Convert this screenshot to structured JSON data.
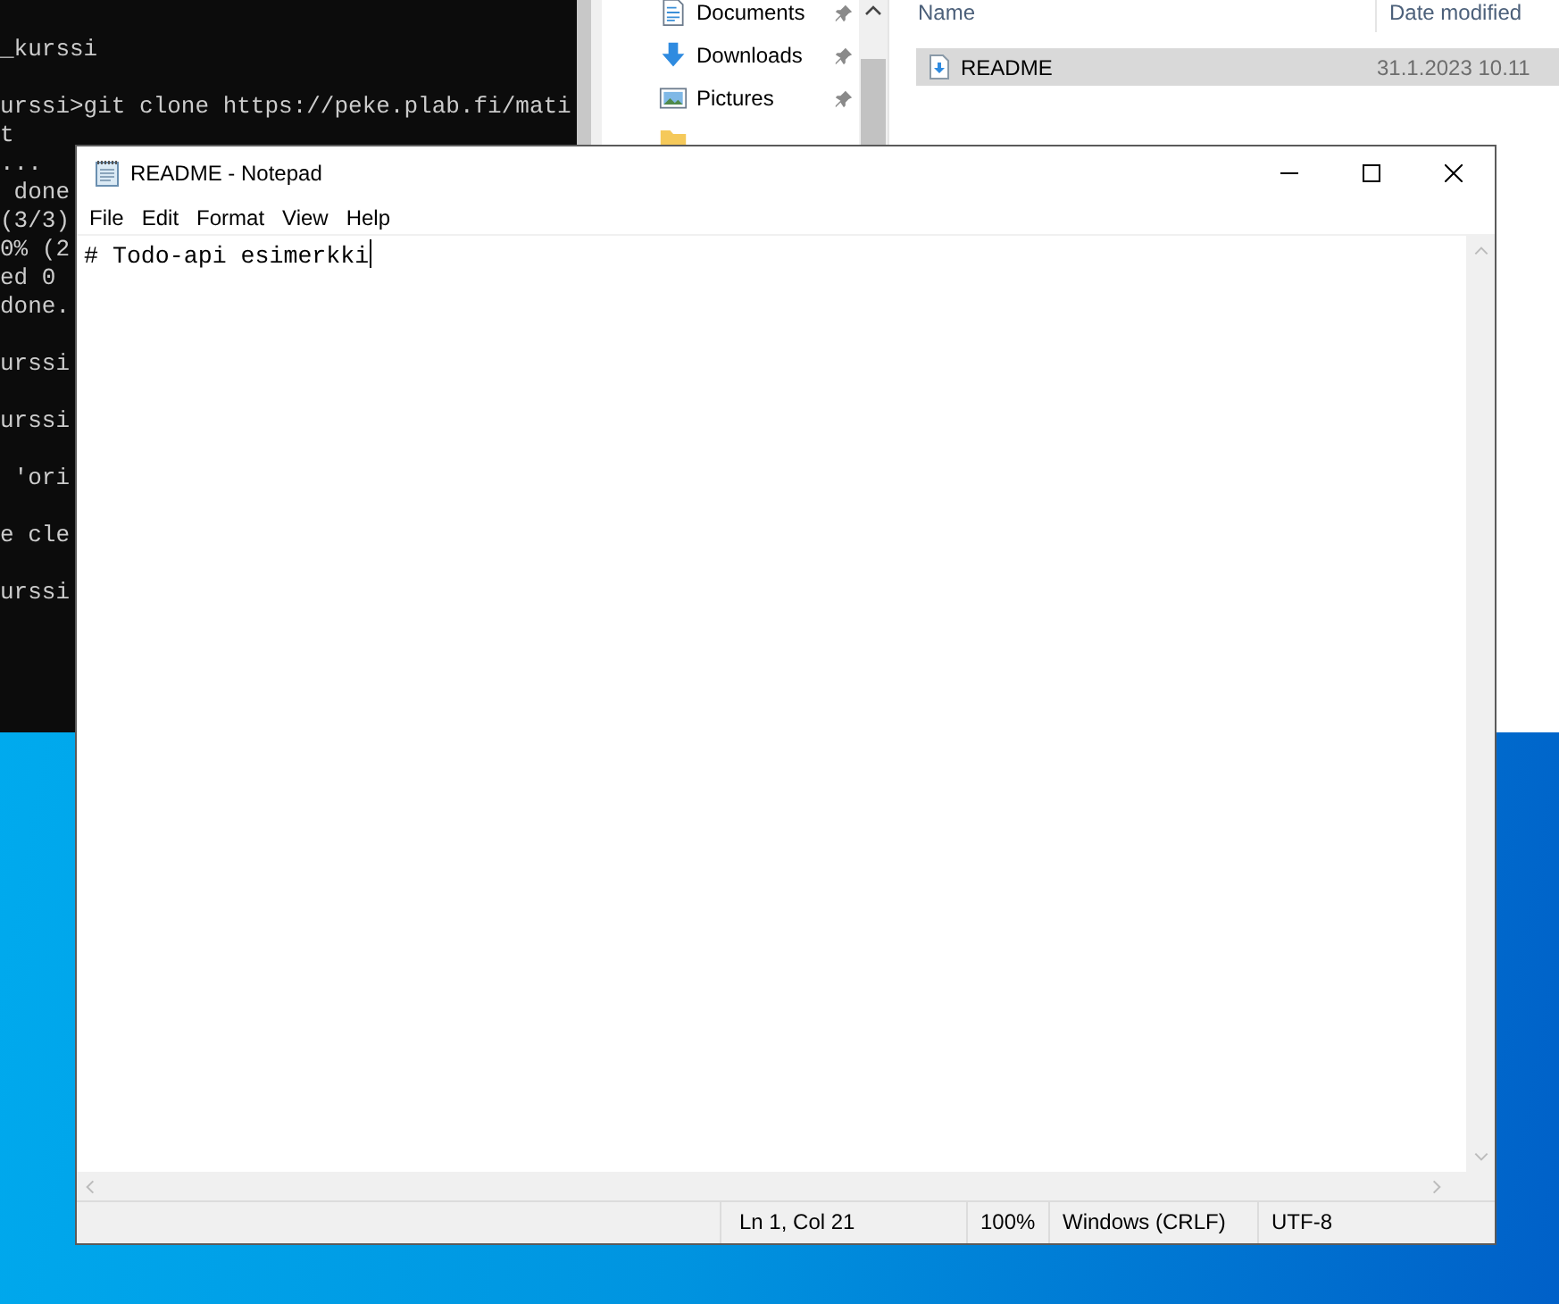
{
  "terminal": {
    "lines": [
      {
        "text": "_kurssi",
        "gap_before": true
      },
      {
        "text": "urssi>git clone https://peke.plab.fi/mati",
        "gap_before": true
      },
      {
        "text": "t",
        "gap_before": false
      },
      {
        "text": "...",
        "gap_before": false
      },
      {
        "text": " done",
        "gap_before": false
      },
      {
        "text": "(3/3)",
        "gap_before": false
      },
      {
        "text": "0% (2",
        "gap_before": false
      },
      {
        "text": "ed 0",
        "gap_before": false
      },
      {
        "text": "done.",
        "gap_before": false
      },
      {
        "text": "urssi",
        "gap_before": true
      },
      {
        "text": "urssi",
        "gap_before": true
      },
      {
        "text": " 'ori",
        "gap_before": true
      },
      {
        "text": "e cle",
        "gap_before": true
      },
      {
        "text": "urssi",
        "gap_before": true
      }
    ]
  },
  "explorer": {
    "nav_items": [
      {
        "label": "Documents",
        "kind": "documents",
        "pinned": true
      },
      {
        "label": "Downloads",
        "kind": "downloads",
        "pinned": true
      },
      {
        "label": "Pictures",
        "kind": "pictures",
        "pinned": true
      }
    ],
    "partial_item": {
      "kind": "folder"
    },
    "columns": [
      "Name",
      "Date modified"
    ],
    "files": [
      {
        "name": "README",
        "date": "31.1.2023 10.11",
        "selected": true
      }
    ]
  },
  "notepad": {
    "title": "README - Notepad",
    "menu": [
      "File",
      "Edit",
      "Format",
      "View",
      "Help"
    ],
    "content": "# Todo-api esimerkki",
    "status": {
      "position": "Ln 1, Col 21",
      "zoom": "100%",
      "line_ending": "Windows (CRLF)",
      "encoding": "UTF-8"
    }
  }
}
